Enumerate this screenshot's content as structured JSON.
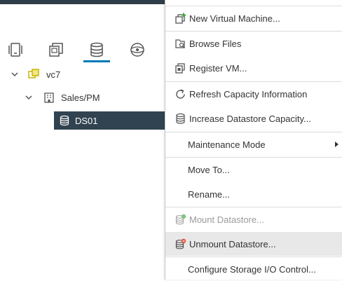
{
  "tabs": [
    {
      "name": "hosts-clusters-icon"
    },
    {
      "name": "vms-templates-icon"
    },
    {
      "name": "storage-icon"
    },
    {
      "name": "networking-icon"
    }
  ],
  "tree": {
    "vcenter": {
      "label": "vc7"
    },
    "datacenter": {
      "label": "Sales/PM"
    },
    "datastore": {
      "label": "DS01"
    }
  },
  "menu": {
    "items": [
      {
        "label": "New Virtual Machine...",
        "icon": "new-vm-icon"
      },
      {
        "label": "Browse Files",
        "icon": "browse-files-icon"
      },
      {
        "label": "Register VM...",
        "icon": "register-vm-icon"
      },
      {
        "label": "Refresh Capacity Information",
        "icon": "refresh-icon"
      },
      {
        "label": "Increase Datastore Capacity...",
        "icon": "datastore-icon"
      },
      {
        "label": "Maintenance Mode",
        "icon": "",
        "submenu": true
      },
      {
        "label": "Move To...",
        "icon": ""
      },
      {
        "label": "Rename...",
        "icon": ""
      },
      {
        "label": "Mount Datastore...",
        "icon": "mount-datastore-icon",
        "disabled": true
      },
      {
        "label": "Unmount Datastore...",
        "icon": "unmount-datastore-icon",
        "hovered": true
      },
      {
        "label": "Configure Storage I/O Control...",
        "icon": ""
      }
    ]
  },
  "colors": {
    "accent": "#0079b8",
    "selected_row": "#314351",
    "header_bar": "#2f3d48",
    "hover": "#e8e8e8"
  }
}
